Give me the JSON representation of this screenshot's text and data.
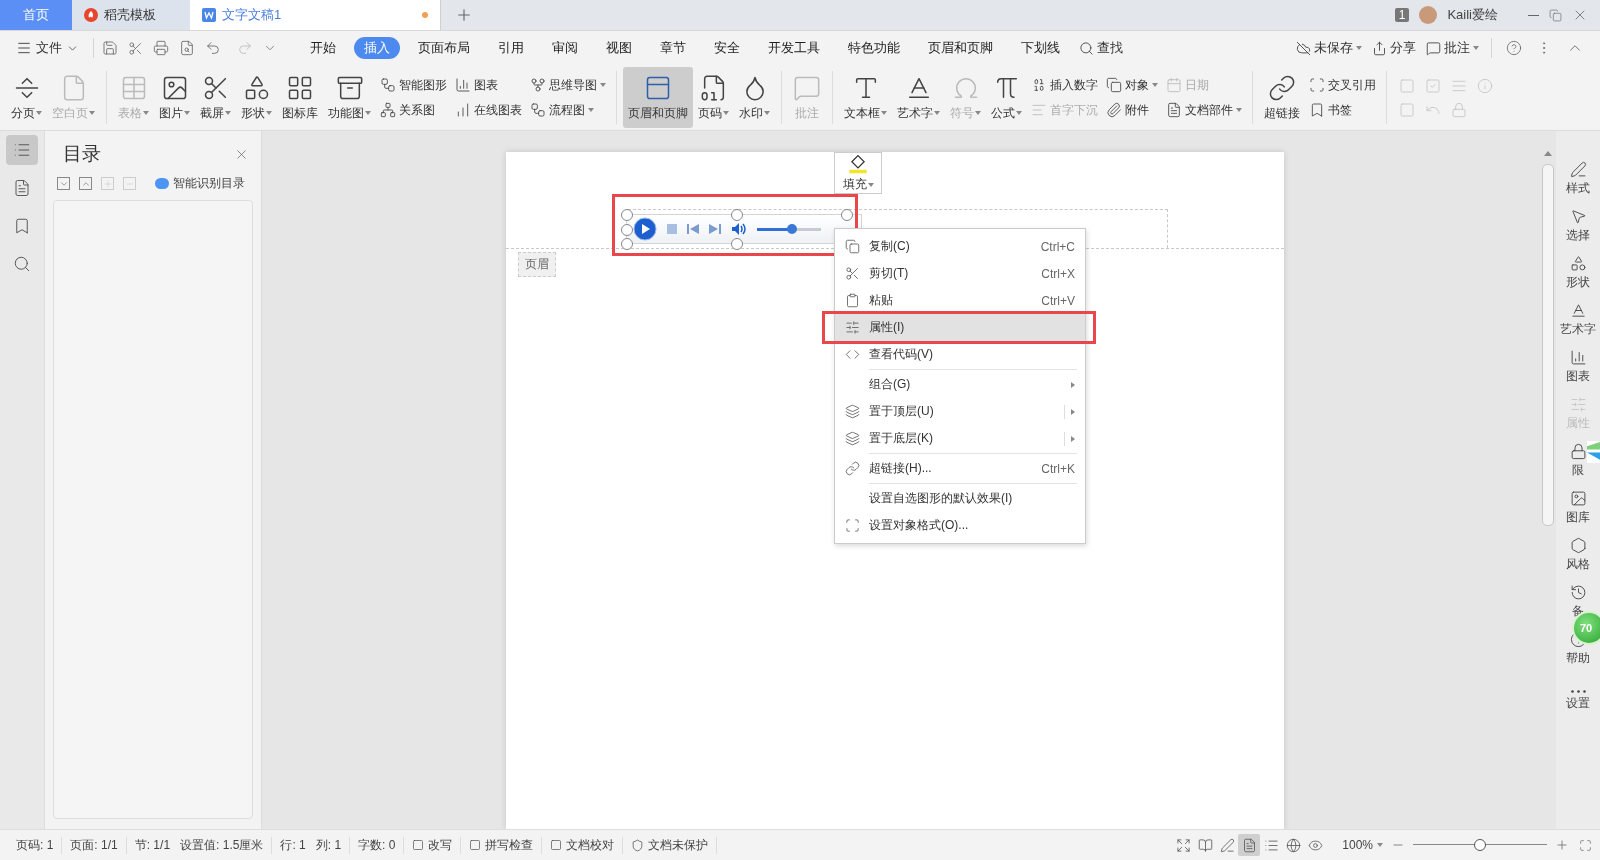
{
  "title_bar": {
    "tabs": [
      {
        "label": "首页",
        "kind": "home",
        "selected": false
      },
      {
        "label": "稻壳模板",
        "kind": "template",
        "selected": false
      },
      {
        "label": "文字文稿1",
        "kind": "document",
        "selected": true,
        "unsaved": true
      }
    ],
    "window_count": "1",
    "user": "Kaili爱绘"
  },
  "menu": {
    "file": "文件",
    "tabs": [
      {
        "label": "开始",
        "selected": false
      },
      {
        "label": "插入",
        "selected": true
      },
      {
        "label": "页面布局",
        "selected": false
      },
      {
        "label": "引用",
        "selected": false
      },
      {
        "label": "审阅",
        "selected": false
      },
      {
        "label": "视图",
        "selected": false
      },
      {
        "label": "章节",
        "selected": false
      },
      {
        "label": "安全",
        "selected": false
      },
      {
        "label": "开发工具",
        "selected": false
      },
      {
        "label": "特色功能",
        "selected": false
      },
      {
        "label": "页眉和页脚",
        "selected": false
      },
      {
        "label": "下划线",
        "selected": false
      }
    ],
    "search": "查找",
    "actions": [
      {
        "label": "未保存",
        "dropdown": true
      },
      {
        "label": "分享",
        "dropdown": false
      },
      {
        "label": "批注",
        "dropdown": true
      }
    ]
  },
  "ribbon": [
    {
      "kind": "large",
      "label": "分页",
      "dropdown": true,
      "disabled": false,
      "selected": false
    },
    {
      "kind": "large",
      "label": "空白页",
      "dropdown": true,
      "disabled": true,
      "selected": false
    },
    {
      "kind": "separator"
    },
    {
      "kind": "large",
      "label": "表格",
      "dropdown": true,
      "disabled": true,
      "selected": false
    },
    {
      "kind": "large",
      "label": "图片",
      "dropdown": true,
      "disabled": false,
      "selected": false
    },
    {
      "kind": "large",
      "label": "截屏",
      "dropdown": true,
      "disabled": false,
      "selected": false
    },
    {
      "kind": "large",
      "label": "形状",
      "dropdown": true,
      "disabled": false,
      "selected": false
    },
    {
      "kind": "large",
      "label": "图标库",
      "dropdown": false,
      "disabled": false,
      "selected": false
    },
    {
      "kind": "large",
      "label": "功能图",
      "dropdown": true,
      "disabled": false,
      "selected": false
    },
    {
      "kind": "stack",
      "items": [
        {
          "label": "智能图形",
          "dropdown": false,
          "disabled": false
        },
        {
          "label": "关系图",
          "dropdown": false,
          "disabled": false
        }
      ]
    },
    {
      "kind": "stack",
      "items": [
        {
          "label": "图表",
          "dropdown": false,
          "disabled": false
        },
        {
          "label": "在线图表",
          "dropdown": false,
          "disabled": false
        }
      ]
    },
    {
      "kind": "stack",
      "items": [
        {
          "label": "思维导图",
          "dropdown": true,
          "disabled": false
        },
        {
          "label": "流程图",
          "dropdown": true,
          "disabled": false
        }
      ]
    },
    {
      "kind": "separator"
    },
    {
      "kind": "large",
      "label": "页眉和页脚",
      "dropdown": false,
      "disabled": false,
      "selected": true
    },
    {
      "kind": "large",
      "label": "页码",
      "dropdown": true,
      "disabled": false,
      "selected": false
    },
    {
      "kind": "large",
      "label": "水印",
      "dropdown": true,
      "disabled": false,
      "selected": false
    },
    {
      "kind": "separator"
    },
    {
      "kind": "large",
      "label": "批注",
      "dropdown": false,
      "disabled": true,
      "selected": false
    },
    {
      "kind": "separator"
    },
    {
      "kind": "large",
      "label": "文本框",
      "dropdown": true,
      "disabled": false,
      "selected": false
    },
    {
      "kind": "large",
      "label": "艺术字",
      "dropdown": true,
      "disabled": false,
      "selected": false
    },
    {
      "kind": "large",
      "label": "符号",
      "dropdown": true,
      "disabled": true,
      "selected": false
    },
    {
      "kind": "large",
      "label": "公式",
      "dropdown": true,
      "disabled": false,
      "selected": false
    },
    {
      "kind": "stack",
      "items": [
        {
          "label": "插入数字",
          "dropdown": false,
          "disabled": false
        },
        {
          "label": "首字下沉",
          "dropdown": false,
          "disabled": true
        }
      ]
    },
    {
      "kind": "stack",
      "items": [
        {
          "label": "对象",
          "dropdown": true,
          "disabled": false
        },
        {
          "label": "附件",
          "dropdown": false,
          "disabled": false
        }
      ]
    },
    {
      "kind": "stack",
      "items": [
        {
          "label": "日期",
          "dropdown": false,
          "disabled": true
        },
        {
          "label": "文档部件",
          "dropdown": true,
          "disabled": false
        }
      ]
    },
    {
      "kind": "separator"
    },
    {
      "kind": "large",
      "label": "超链接",
      "dropdown": false,
      "disabled": false,
      "selected": false
    },
    {
      "kind": "stack",
      "items": [
        {
          "label": "交叉引用",
          "dropdown": false,
          "disabled": false
        },
        {
          "label": "书签",
          "dropdown": false,
          "disabled": false
        }
      ]
    },
    {
      "kind": "separator"
    },
    {
      "kind": "grid",
      "items": [
        {
          "disabled": true
        },
        {
          "disabled": true
        },
        {
          "disabled": true
        },
        {
          "disabled": true
        },
        {
          "disabled": true
        },
        {
          "disabled": true
        },
        {
          "disabled": true
        }
      ]
    }
  ],
  "left_strip": [
    {
      "selected": true
    },
    {
      "selected": false
    },
    {
      "selected": false
    },
    {
      "selected": false
    }
  ],
  "toc_panel": {
    "title": "目录",
    "buttons": [
      {
        "disabled": false
      },
      {
        "disabled": false
      },
      {
        "disabled": true
      },
      {
        "disabled": true
      }
    ],
    "smart_button": "智能识别目录"
  },
  "document": {
    "header_label": "页眉",
    "fill_button": "填充",
    "media_player": {
      "outlined": true,
      "volume": {
        "level": 0.55
      }
    },
    "context_menu": [
      {
        "kind": "item",
        "label": "复制(C)",
        "shortcut": "Ctrl+C",
        "selected": false
      },
      {
        "kind": "item",
        "label": "剪切(T)",
        "shortcut": "Ctrl+X",
        "selected": false
      },
      {
        "kind": "item",
        "label": "粘贴",
        "shortcut": "Ctrl+V",
        "selected": false
      },
      {
        "kind": "item",
        "label": "属性(I)",
        "selected": true,
        "outlined": true
      },
      {
        "kind": "item",
        "label": "查看代码(V)",
        "selected": false
      },
      {
        "kind": "separator"
      },
      {
        "kind": "item",
        "label": "组合(G)",
        "submenu": true,
        "selected": false
      },
      {
        "kind": "item",
        "label": "置于顶层(U)",
        "submenu": true,
        "split": true,
        "selected": false
      },
      {
        "kind": "item",
        "label": "置于底层(K)",
        "submenu": true,
        "split": true,
        "selected": false
      },
      {
        "kind": "separator"
      },
      {
        "kind": "item",
        "label": "超链接(H)...",
        "shortcut": "Ctrl+K",
        "selected": false
      },
      {
        "kind": "separator"
      },
      {
        "kind": "item",
        "label": "设置自选图形的默认效果(I)",
        "selected": false
      },
      {
        "kind": "item",
        "label": "设置对象格式(O)...",
        "selected": false
      }
    ]
  },
  "right_sidebar": [
    {
      "label": "样式",
      "disabled": false
    },
    {
      "label": "选择",
      "disabled": false
    },
    {
      "label": "形状",
      "disabled": false
    },
    {
      "label": "艺术字",
      "disabled": false
    },
    {
      "label": "图表",
      "disabled": false
    },
    {
      "label": "属性",
      "disabled": true
    },
    {
      "label": "限",
      "disabled": false
    },
    {
      "label": "图库",
      "disabled": false
    },
    {
      "label": "风格",
      "disabled": false
    },
    {
      "label": "备",
      "disabled": false
    },
    {
      "label": "帮助",
      "disabled": false
    },
    {
      "label": "设置",
      "disabled": false
    }
  ],
  "floating_badge": "70",
  "status_bar": {
    "groups": [
      [
        {
          "label": "页码: 1",
          "kind": "text"
        }
      ],
      [
        {
          "label": "页面: 1/1",
          "kind": "text"
        }
      ],
      [
        {
          "label": "节: 1/1",
          "kind": "text"
        },
        {
          "label": "设置值: 1.5厘米",
          "kind": "text"
        }
      ],
      [
        {
          "label": "行: 1",
          "kind": "text"
        },
        {
          "label": "列: 1",
          "kind": "text"
        }
      ],
      [
        {
          "label": "字数: 0",
          "kind": "text"
        }
      ],
      [
        {
          "label": "改写",
          "kind": "toggle"
        }
      ],
      [
        {
          "label": "拼写检查",
          "kind": "toggle"
        }
      ],
      [
        {
          "label": "文档校对",
          "kind": "toggle"
        }
      ],
      [
        {
          "label": "文档未保护",
          "kind": "protect"
        }
      ]
    ],
    "views": [
      {
        "selected": false
      },
      {
        "selected": false
      },
      {
        "selected": false
      },
      {
        "selected": true
      },
      {
        "selected": false
      },
      {
        "selected": false
      },
      {
        "selected": false
      }
    ],
    "zoom": {
      "value": "100%",
      "level": 0.5
    }
  }
}
